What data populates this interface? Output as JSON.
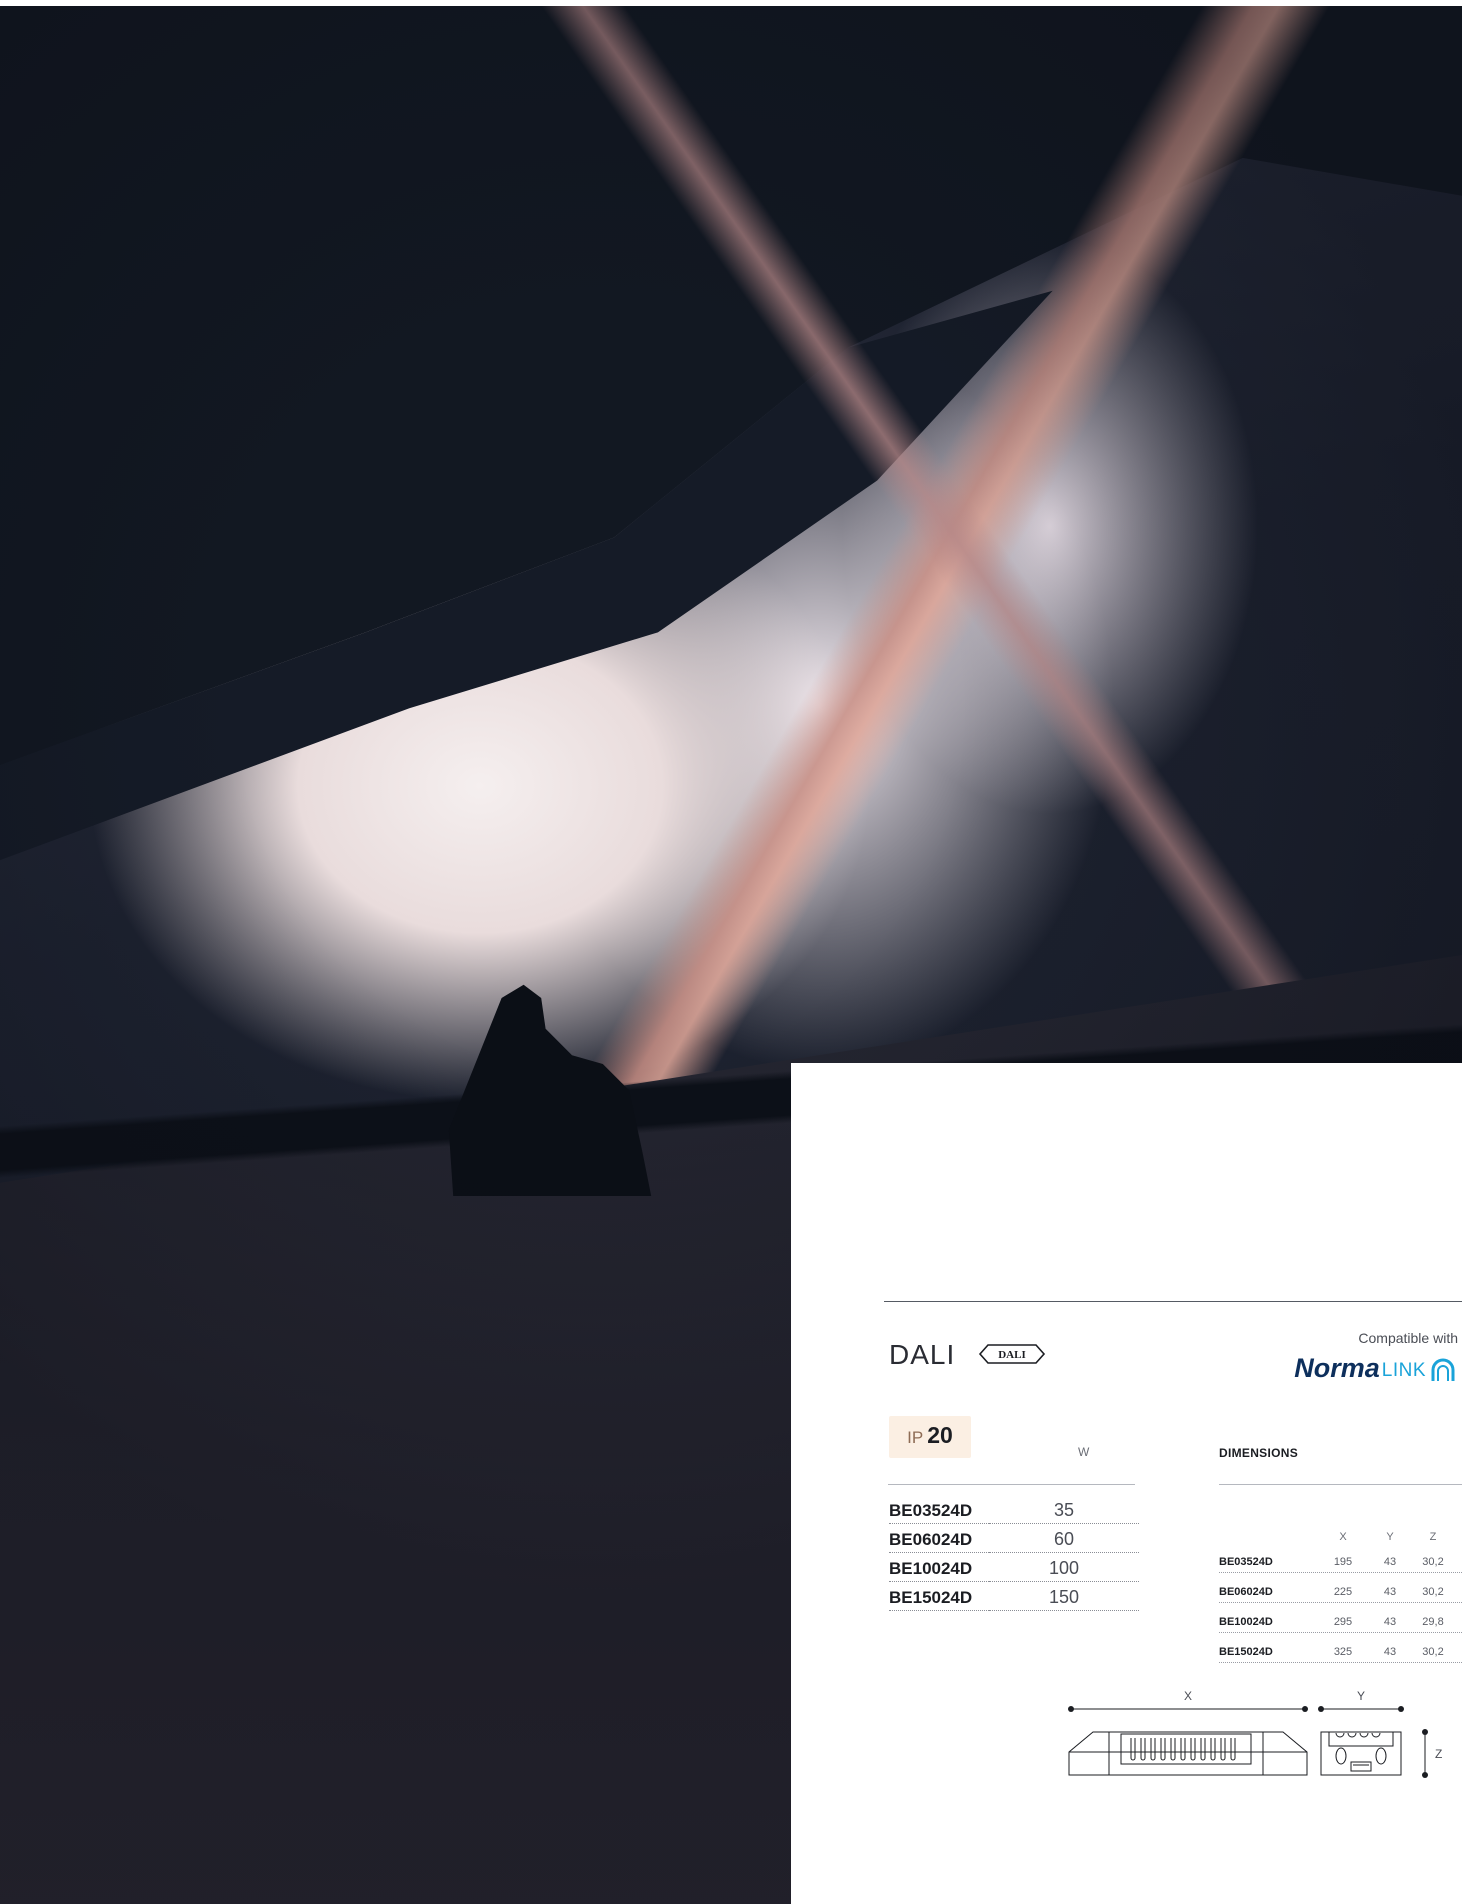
{
  "photo": {
    "alt": "Interior atrium with sweeping escalator ramps and a silhouetted person"
  },
  "product": {
    "protocol": "DALI",
    "protocol_logo_text": "DALI",
    "compatible_label": "Compatible with",
    "compat_brand": "Norma",
    "compat_brand_suffix": "LINK",
    "ip_label": "IP",
    "ip_value": "20",
    "power_header": "W",
    "dimensions_header": "DIMENSIONS",
    "power_rows": [
      {
        "code": "BE03524D",
        "watt": "35"
      },
      {
        "code": "BE06024D",
        "watt": "60"
      },
      {
        "code": "BE10024D",
        "watt": "100"
      },
      {
        "code": "BE15024D",
        "watt": "150"
      }
    ],
    "dim_columns": [
      "X",
      "Y",
      "Z"
    ],
    "dim_rows": [
      {
        "code": "BE03524D",
        "x": "195",
        "y": "43",
        "z": "30,2"
      },
      {
        "code": "BE06024D",
        "x": "225",
        "y": "43",
        "z": "30,2"
      },
      {
        "code": "BE10024D",
        "x": "295",
        "y": "43",
        "z": "29,8"
      },
      {
        "code": "BE15024D",
        "x": "325",
        "y": "43",
        "z": "30,2"
      }
    ],
    "drawing_labels": {
      "x": "X",
      "y": "Y",
      "z": "Z"
    }
  }
}
